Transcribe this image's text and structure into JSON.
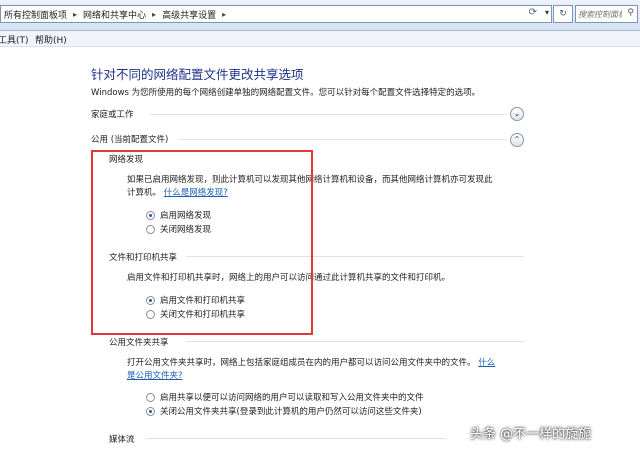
{
  "address_bar": {
    "crumbs": [
      "所有控制面板项",
      "网络和共享中心",
      "高级共享设置"
    ],
    "search_placeholder": "搜索控制面板"
  },
  "menu": {
    "items": [
      "工具(T)",
      "帮助(H)"
    ]
  },
  "page": {
    "title": "针对不同的网络配置文件更改共享选项",
    "description": "Windows 为您所使用的每个网络创建单独的网络配置文件。您可以针对每个配置文件选择特定的选项。"
  },
  "profiles": {
    "home_work": "家庭或工作",
    "public": "公用 (当前配置文件)"
  },
  "network_discovery": {
    "heading": "网络发现",
    "text_line1": "如果已启用网络发现，则此计算机可以发现其他网络计算机和设备，而其他网络计算机亦可发现此",
    "text_line2": "计算机。",
    "link": "什么是网络发现?",
    "opt_on": "启用网络发现",
    "opt_off": "关闭网络发现",
    "selected": "on"
  },
  "file_printer": {
    "heading": "文件和打印机共享",
    "text": "启用文件和打印机共享时，网络上的用户可以访问通过此计算机共享的文件和打印机。",
    "opt_on": "启用文件和打印机共享",
    "opt_off": "关闭文件和打印机共享",
    "selected": "on"
  },
  "public_folder": {
    "heading": "公用文件夹共享",
    "text_line1": "打开公用文件夹共享时，网络上包括家庭组成员在内的用户都可以访问公用文件夹中的文件。",
    "link_part1": "什么",
    "link_part2": "是公用文件夹?",
    "opt_on": "启用共享以便可以访问网络的用户可以读取和写入公用文件夹中的文件",
    "opt_off": "关闭公用文件夹共享(登录到此计算机的用户仍然可以访问这些文件夹)",
    "selected": "off"
  },
  "media": {
    "heading": "媒体流"
  },
  "watermark": "头条 @不一样的旋旎",
  "colors": {
    "title": "#1e3287",
    "link": "#1a5fb4",
    "highlight_box": "#e0393b"
  }
}
